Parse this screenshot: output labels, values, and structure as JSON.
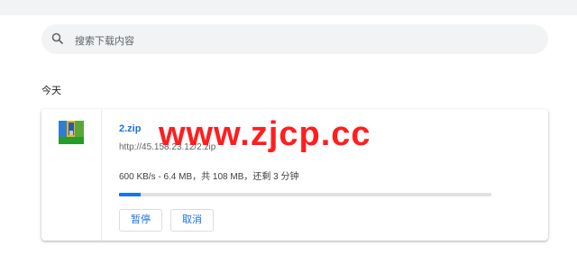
{
  "search": {
    "placeholder": "搜索下载内容",
    "icon": "search-icon"
  },
  "section": {
    "date_label": "今天"
  },
  "download": {
    "icon": "archive-file-icon",
    "file_name": "2.zip",
    "url": "http://45.158.23.12/2.zip",
    "status": "600 KB/s - 6.4 MB，共 108 MB，还剩 3 分钟",
    "progress_fraction": 0.059,
    "pause_label": "暂停",
    "cancel_label": "取消"
  },
  "watermark": {
    "text": "www.zjcp.cc"
  },
  "colors": {
    "accent": "#1a73e8",
    "watermark": "#ff1e1e"
  }
}
